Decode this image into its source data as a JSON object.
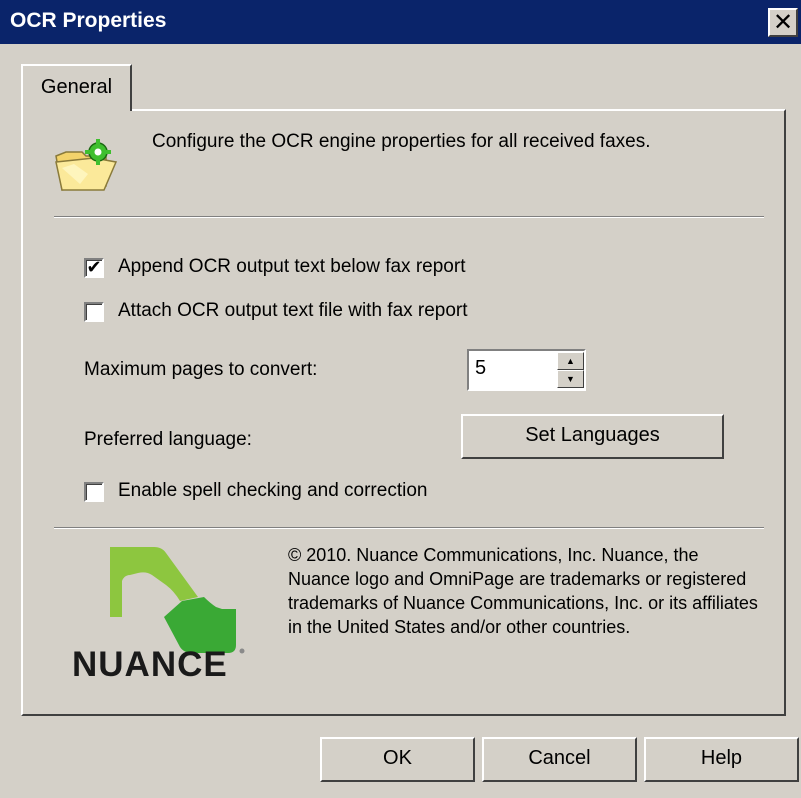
{
  "window": {
    "title": "OCR Properties",
    "close_glyph": "✕"
  },
  "tabs": [
    {
      "label": "General"
    }
  ],
  "header": {
    "icon": "folder-gear-icon",
    "description": "Configure the OCR engine properties for all received faxes."
  },
  "options": {
    "append_ocr": {
      "label": "Append OCR output text below fax report",
      "checked": true
    },
    "attach_ocr": {
      "label": "Attach OCR output text file with fax report",
      "checked": false
    },
    "max_pages": {
      "label": "Maximum pages to convert:",
      "value": "5"
    },
    "language": {
      "label": "Preferred language:",
      "button_label": "Set Languages"
    },
    "spell_check": {
      "label": "Enable spell checking and correction",
      "checked": false
    }
  },
  "footer": {
    "logo_icon": "nuance-logo",
    "logo_text": "NUANCE",
    "copyright": "© 2010. Nuance Communications, Inc. Nuance, the Nuance logo and OmniPage are trademarks or registered trademarks of Nuance Communications, Inc. or its affiliates in the United States and/or other countries."
  },
  "buttons": {
    "ok": "OK",
    "cancel": "Cancel",
    "help": "Help"
  },
  "colors": {
    "titlebar": "#0a246a",
    "dialog_bg": "#d4d0c8",
    "logo_green_light": "#8dc63f",
    "logo_green_dark": "#3aa935"
  }
}
